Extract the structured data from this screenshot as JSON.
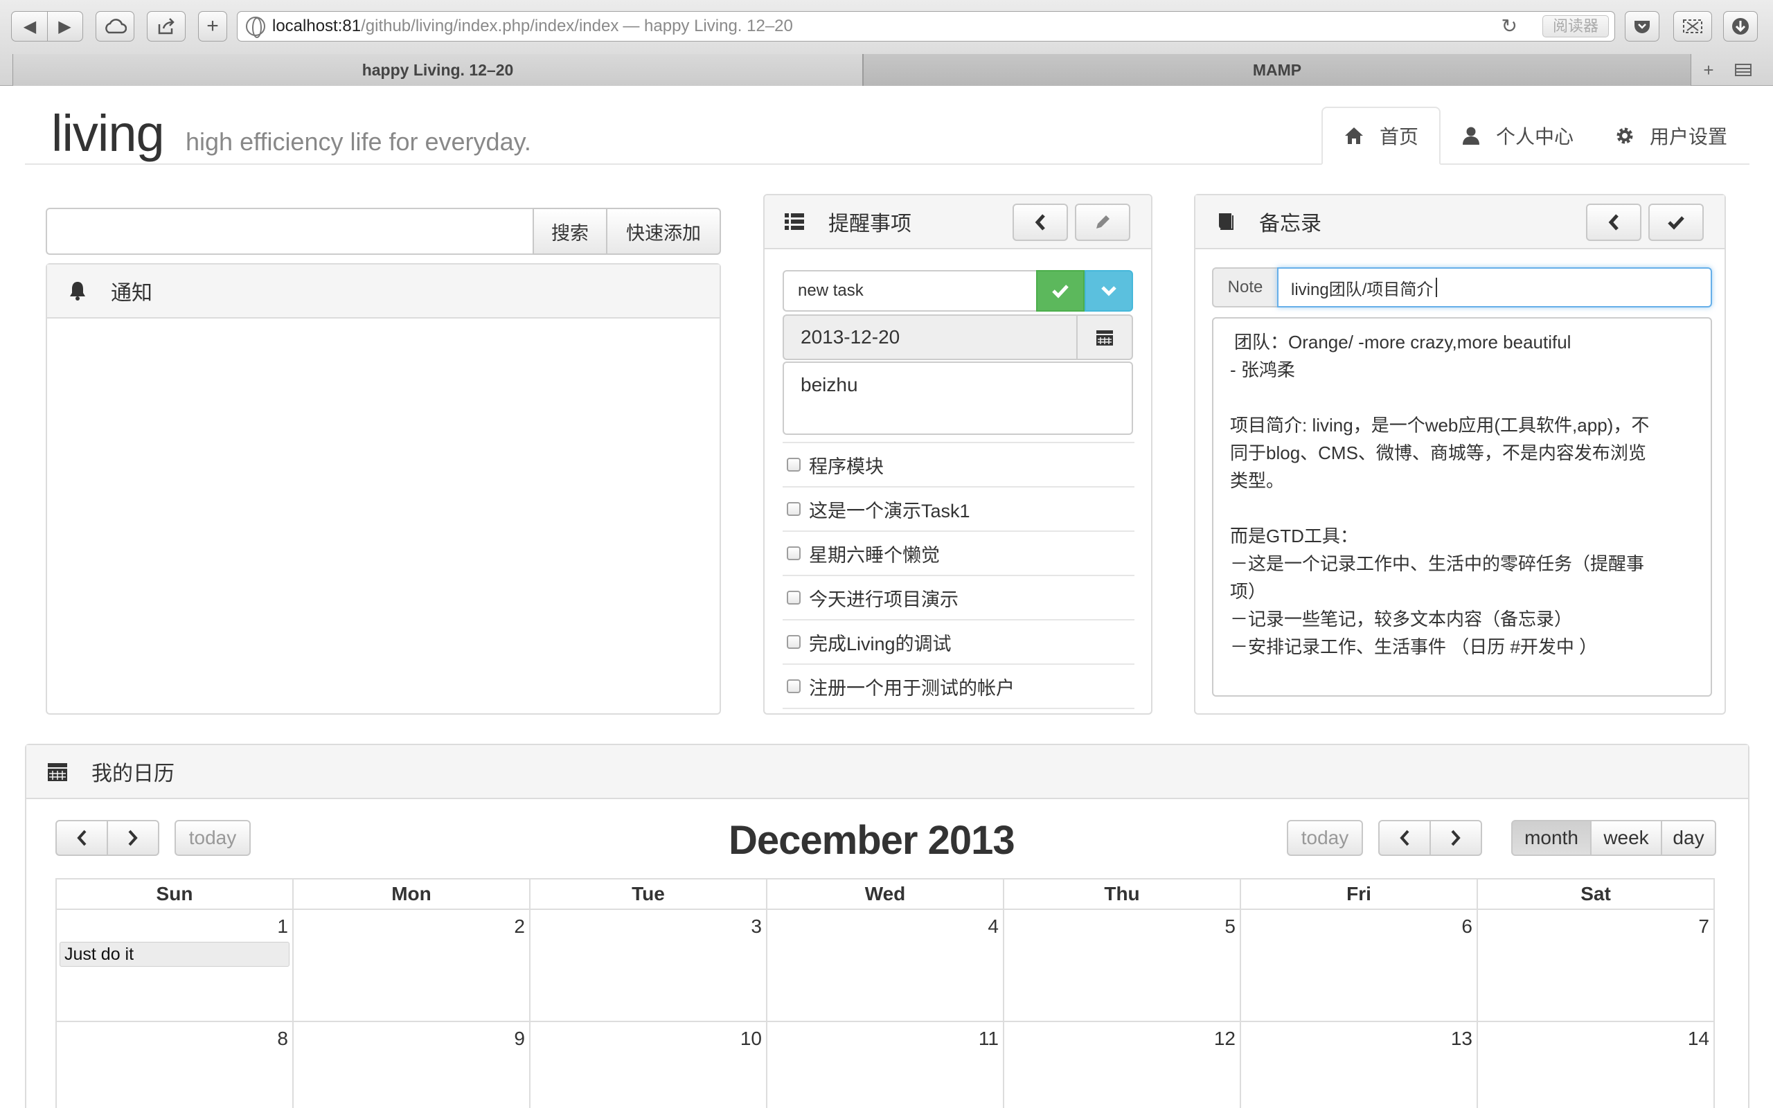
{
  "browser": {
    "url_host": "localhost:81",
    "url_path": "/github/living/index.php/index/index",
    "url_title": "— happy Living. 12–20",
    "reader_label": "阅读器",
    "tabs": [
      {
        "label": "happy Living. 12–20"
      },
      {
        "label": "MAMP"
      }
    ]
  },
  "header": {
    "brand": "living",
    "tagline": "high efficiency life for everyday.",
    "nav": [
      {
        "label": "首页",
        "icon": "home-icon"
      },
      {
        "label": "个人中心",
        "icon": "user-icon"
      },
      {
        "label": "用户设置",
        "icon": "gear-icon"
      }
    ]
  },
  "search": {
    "value": "",
    "search_label": "搜索",
    "quick_add_label": "快速添加"
  },
  "notifications": {
    "title": "通知",
    "icon": "bell-icon"
  },
  "reminders": {
    "title": "提醒事项",
    "icon": "list-icon",
    "new_task_value": "new task",
    "date_value": "2013-12-20",
    "note_value": "beizhu",
    "tasks": [
      {
        "label": "程序模块",
        "checked": false
      },
      {
        "label": "这是一个演示Task1",
        "checked": false
      },
      {
        "label": "星期六睡个懒觉",
        "checked": false
      },
      {
        "label": "今天进行项目演示",
        "checked": false
      },
      {
        "label": "完成Living的调试",
        "checked": false
      },
      {
        "label": "注册一个用于测试的帐户",
        "checked": false
      }
    ],
    "colors": {
      "confirm": "#5cb85c",
      "dropdown": "#5bc0de"
    }
  },
  "memo": {
    "title": "备忘录",
    "icon": "book-icon",
    "note_addon": "Note",
    "note_title_value": "living团队/项目简介",
    "lines": [
      "团队：Orange/ -more crazy,more beautiful",
      "- 张鸿柔",
      "",
      "项目简介: living，是一个web应用(工具软件,app)，不",
      "同于blog、CMS、微博、商城等，不是内容发布浏览",
      "类型。",
      "",
      "而是GTD工具：",
      "－这是一个记录工作中、生活中的零碎任务（提醒事",
      "项）",
      "－记录一些笔记，较多文本内容（备忘录）",
      "－安排记录工作、生活事件 （日历 #开发中 ）"
    ]
  },
  "calendar": {
    "panel_title": "我的日历",
    "icon": "calendar-icon",
    "title": "December 2013",
    "today_label": "today",
    "views": [
      "month",
      "week",
      "day"
    ],
    "active_view": "month",
    "weekdays": [
      "Sun",
      "Mon",
      "Tue",
      "Wed",
      "Thu",
      "Fri",
      "Sat"
    ],
    "weeks": [
      [
        "1",
        "2",
        "3",
        "4",
        "5",
        "6",
        "7"
      ],
      [
        "8",
        "9",
        "10",
        "11",
        "12",
        "13",
        "14"
      ]
    ],
    "events": [
      {
        "day": "1",
        "title": "Just do it"
      }
    ]
  }
}
